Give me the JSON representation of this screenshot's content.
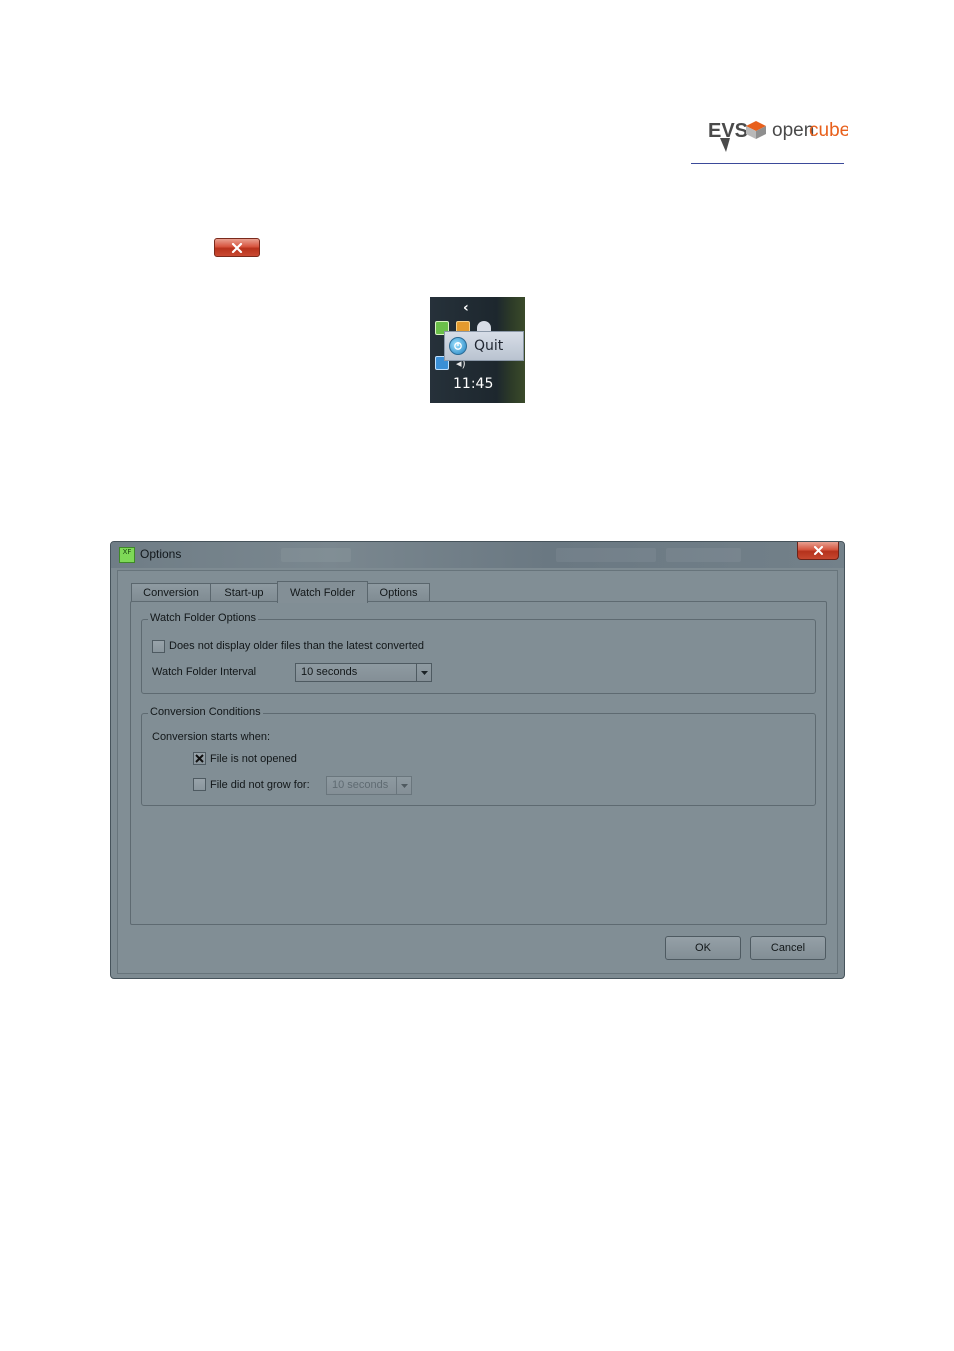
{
  "logo": {
    "brand_left": "EVS",
    "brand_right_a": "open",
    "brand_right_b": "cube",
    "colors": {
      "dark": "#4a4a4a",
      "accent": "#e8601c"
    }
  },
  "tray": {
    "menu_item_label": "Quit",
    "clock": "11:45"
  },
  "dialog": {
    "title": "Options",
    "app_icon_text": "XF",
    "tabs": [
      {
        "label": "Conversion"
      },
      {
        "label": "Start-up"
      },
      {
        "label": "Watch Folder"
      },
      {
        "label": "Options"
      }
    ],
    "active_tab": "Watch Folder",
    "watch_folder_options": {
      "legend": "Watch Folder Options",
      "older_files_label": "Does not display older files than the latest converted",
      "older_files_checked": false,
      "interval_label": "Watch Folder Interval",
      "interval_value": "10 seconds"
    },
    "conversion_conditions": {
      "legend": "Conversion Conditions",
      "starts_when_label": "Conversion starts when:",
      "not_opened_label": "File is not opened",
      "not_opened_checked": true,
      "not_grow_label": "File did not grow for:",
      "not_grow_checked": false,
      "not_grow_value": "10 seconds"
    },
    "ok_label": "OK",
    "cancel_label": "Cancel"
  }
}
